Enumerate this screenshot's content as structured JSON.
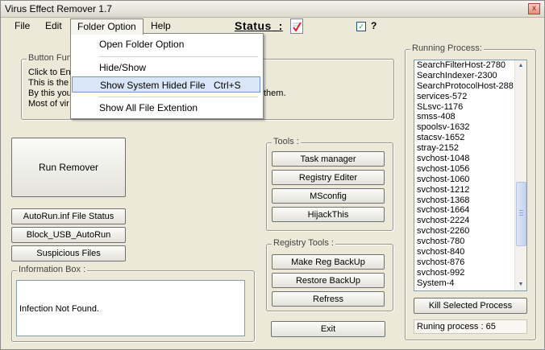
{
  "window": {
    "title": "Virus Effect Remover 1.7",
    "close_glyph": "x"
  },
  "menubar": {
    "items": [
      {
        "label": "File"
      },
      {
        "label": "Edit"
      },
      {
        "label": "Folder Option"
      },
      {
        "label": "Help"
      }
    ],
    "status_label": "Status",
    "status_colon": ":",
    "status_icon": "notepad-check-icon",
    "help_checkbox_checked": true,
    "help_checkbox_glyph": "✓",
    "help_question": "?"
  },
  "folder_menu": {
    "items": [
      {
        "label": "Open Folder Option",
        "shortcut": ""
      },
      {
        "label": "Hide/Show",
        "shortcut": ""
      },
      {
        "label": "Show System Hided File",
        "shortcut": "Ctrl+S",
        "highlighted": true
      },
      {
        "label": "Show All File Extention",
        "shortcut": ""
      }
    ]
  },
  "button_function": {
    "legend": "Button Fun",
    "lines": [
      "Click to En",
      "This is the",
      "By this you",
      "Most of vir"
    ],
    "partial_tail": "them."
  },
  "actions": {
    "run_remover": "Run Remover",
    "autorun_status": "AutoRun.inf File Status",
    "block_usb": "Block_USB_AutoRun",
    "suspicious_files": "Suspicious Files"
  },
  "tools": {
    "legend": "Tools :",
    "buttons": [
      "Task manager",
      "Registry Editer",
      "MSconfig",
      "HijackThis"
    ]
  },
  "registry_tools": {
    "legend": "Registry Tools :",
    "buttons": [
      "Make Reg  BackUp",
      "Restore BackUp",
      "Refress"
    ]
  },
  "exit_button": "Exit",
  "info_box": {
    "legend": "Information Box :",
    "message": "Infection Not Found."
  },
  "running_process": {
    "legend": "Running Process:",
    "items": [
      "SearchFilterHost-2780",
      "SearchIndexer-2300",
      "SearchProtocolHost-288",
      "services-572",
      "SLsvc-1176",
      "smss-408",
      "spoolsv-1632",
      "stacsv-1652",
      "stray-2152",
      "svchost-1048",
      "svchost-1056",
      "svchost-1060",
      "svchost-1212",
      "svchost-1368",
      "svchost-1664",
      "svchost-2224",
      "svchost-2260",
      "svchost-780",
      "svchost-840",
      "svchost-876",
      "svchost-992",
      "System-4"
    ],
    "kill_button": "Kill Selected Process",
    "count_text": "Runing process : 65"
  },
  "colors": {
    "window_bg": "#ece9d8",
    "highlight": "#d9e6f9",
    "status_check": "#e02020"
  }
}
